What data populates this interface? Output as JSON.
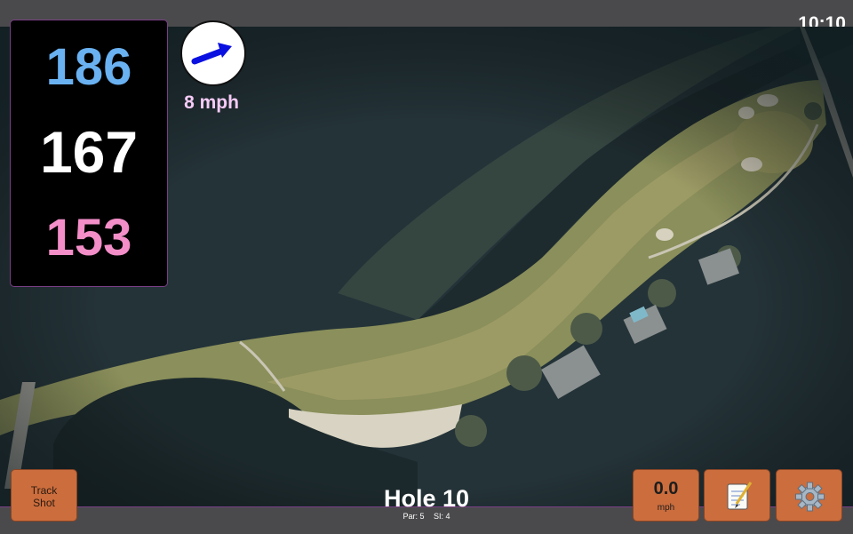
{
  "status": {
    "clock": "10:10"
  },
  "yardages": {
    "back": "186",
    "middle": "167",
    "front": "153"
  },
  "wind": {
    "speed": "8 mph",
    "icon": "wind-direction-arrow-icon"
  },
  "hole": {
    "title": "Hole 10",
    "par": "Par: 5",
    "stroke_index": "SI: 4"
  },
  "buttons": {
    "track_shot": "Track\nShot",
    "speed_value": "0.0",
    "speed_unit": "mph",
    "notes_icon": "notepad-icon",
    "settings_icon": "gear-icon"
  },
  "colors": {
    "back_yardage": "#69b1f1",
    "middle_yardage": "#ffffff",
    "front_yardage": "#f38ec8",
    "button": "#cb6d3d",
    "border_accent": "#7a3f86"
  }
}
